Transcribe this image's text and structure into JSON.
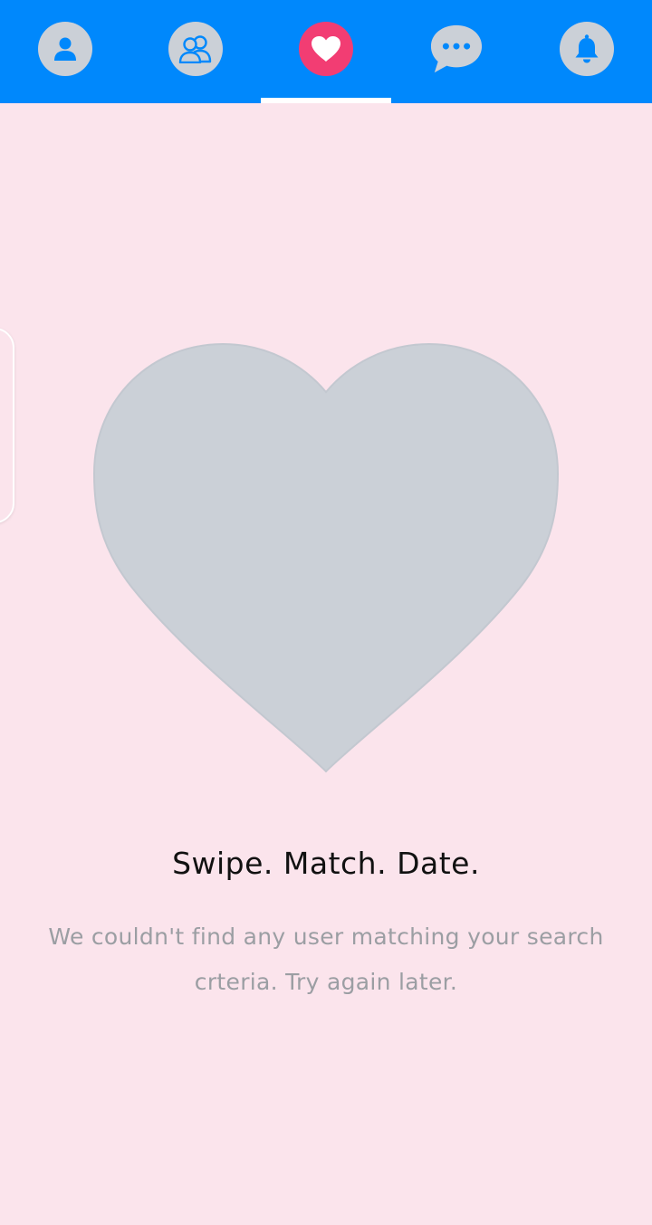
{
  "nav": {
    "tabs": [
      {
        "name": "profile",
        "icon": "person-icon",
        "active": false
      },
      {
        "name": "friends",
        "icon": "people-icon",
        "active": false
      },
      {
        "name": "matches",
        "icon": "heart-icon",
        "active": true
      },
      {
        "name": "messages",
        "icon": "chat-bubble-icon",
        "active": false
      },
      {
        "name": "notifications",
        "icon": "bell-icon",
        "active": false
      }
    ],
    "colors": {
      "bar": "#0088fc",
      "icon_circle": "#cbd0d7",
      "active_circle": "#f23d73",
      "icon_glyph": "#0088fc",
      "active_glyph": "#ffffff"
    }
  },
  "empty_state": {
    "illustration": "heart-icon",
    "title": "Swipe. Match. Date.",
    "message": "We couldn't find any user matching your search crteria. Try again later."
  },
  "colors": {
    "background": "#fbe4ec",
    "heart": "#cbd0d7",
    "title": "#111111",
    "message": "#9b9ea3"
  }
}
